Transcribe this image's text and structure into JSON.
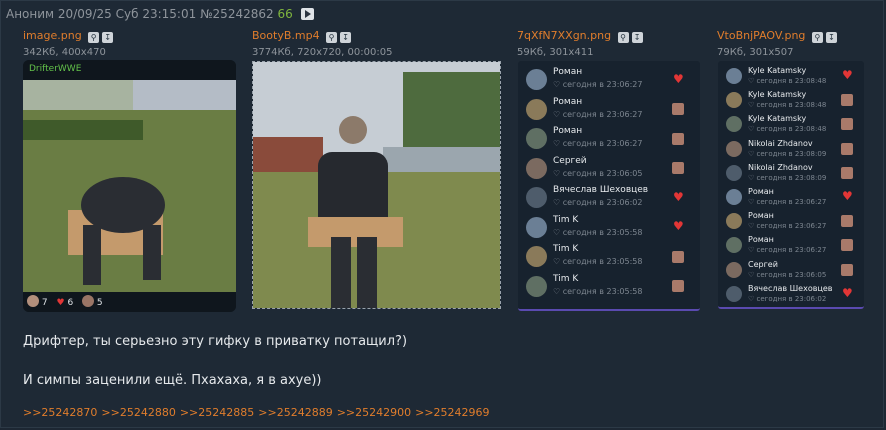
{
  "post": {
    "author": "Аноним",
    "datetime": "20/09/25 Суб 23:15:01",
    "number": "№25242862",
    "count": "66"
  },
  "files": [
    {
      "name": "image.png",
      "meta": "342Кб, 400x470",
      "watermark": "DrifterWWE",
      "reactions": [
        "7",
        "6",
        "5"
      ]
    },
    {
      "name": "BootyB.mp4",
      "meta": "3774Кб, 720x720, 00:00:05"
    },
    {
      "name": "7qXfN7XXgn.png",
      "meta": "59Кб, 301x411",
      "rows": [
        {
          "name": "Роман",
          "time": "сегодня в 23:06:27",
          "reaction": "heart"
        },
        {
          "name": "Роман",
          "time": "сегодня в 23:06:27",
          "reaction": "avatar"
        },
        {
          "name": "Роман",
          "time": "сегодня в 23:06:27",
          "reaction": "avatar"
        },
        {
          "name": "Сергей",
          "time": "сегодня в 23:06:05",
          "reaction": "avatar"
        },
        {
          "name": "Вячеслав Шеховцев",
          "time": "сегодня в 23:06:02",
          "reaction": "heart"
        },
        {
          "name": "Tim K",
          "time": "сегодня в 23:05:58",
          "reaction": "heart"
        },
        {
          "name": "Tim K",
          "time": "сегодня в 23:05:58",
          "reaction": "avatar"
        },
        {
          "name": "Tim K",
          "time": "сегодня в 23:05:58",
          "reaction": "avatar"
        }
      ]
    },
    {
      "name": "VtoBnjPAOV.png",
      "meta": "79Кб, 301x507",
      "rows": [
        {
          "name": "Kyle Katamsky",
          "time": "сегодня в 23:08:48",
          "reaction": "heart"
        },
        {
          "name": "Kyle Katamsky",
          "time": "сегодня в 23:08:48",
          "reaction": "avatar"
        },
        {
          "name": "Kyle Katamsky",
          "time": "сегодня в 23:08:48",
          "reaction": "avatar"
        },
        {
          "name": "Nikolai Zhdanov",
          "time": "сегодня в 23:08:09",
          "reaction": "avatar"
        },
        {
          "name": "Nikolai Zhdanov",
          "time": "сегодня в 23:08:09",
          "reaction": "avatar"
        },
        {
          "name": "Роман",
          "time": "сегодня в 23:06:27",
          "reaction": "heart"
        },
        {
          "name": "Роман",
          "time": "сегодня в 23:06:27",
          "reaction": "avatar"
        },
        {
          "name": "Роман",
          "time": "сегодня в 23:06:27",
          "reaction": "avatar"
        },
        {
          "name": "Сергей",
          "time": "сегодня в 23:06:05",
          "reaction": "avatar"
        },
        {
          "name": "Вячеслав Шеховцев",
          "time": "сегодня в 23:06:02",
          "reaction": "heart"
        }
      ]
    }
  ],
  "message": [
    "Дрифтер, ты серьезно эту гифку в приватку потащил?)",
    "И симпы заценили ещё. Пхахаха, я в ахуе))"
  ],
  "replies": [
    ">>25242870",
    ">>25242880",
    ">>25242885",
    ">>25242889",
    ">>25242900",
    ">>25242969"
  ],
  "colors": {
    "accent": "#e07d2c",
    "count": "#7fb53e",
    "heart": "#e23636",
    "background": "#1e2935"
  }
}
